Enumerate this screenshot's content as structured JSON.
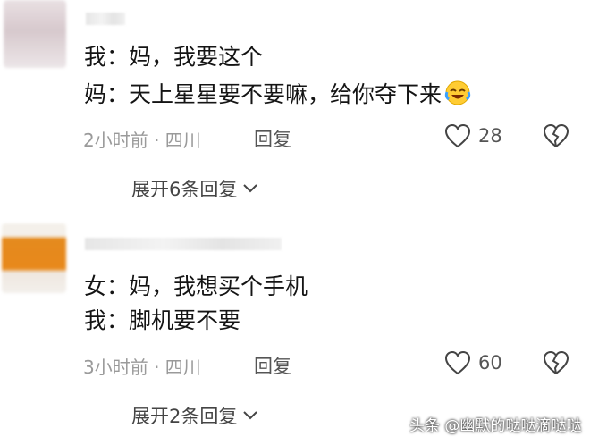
{
  "comments": [
    {
      "lines": [
        "我：妈，我要这个",
        "妈：天上星星要不要嘛，给你夺下来"
      ],
      "emoji_icon": "rolling-laughing-emoji",
      "time": "2小时前 · 四川",
      "reply_label": "回复",
      "likes": "28",
      "expand_label": "展开6条回复"
    },
    {
      "lines": [
        "女：妈，我想买个手机",
        "我：脚机要不要"
      ],
      "time": "3小时前 · 四川",
      "reply_label": "回复",
      "likes": "60",
      "expand_label": "展开2条回复"
    }
  ],
  "watermark": "头条 @幽默的哒哒滴哒哒",
  "colors": {
    "text": "#141414",
    "meta": "#9a9a9a",
    "accent_avatar": "#e8891b"
  }
}
